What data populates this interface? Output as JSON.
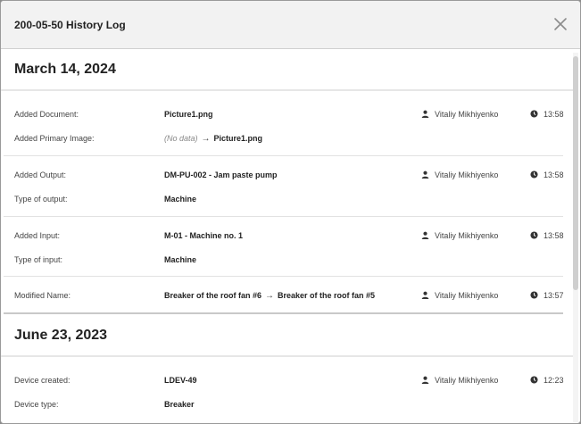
{
  "modal": {
    "title": "200-05-50 History Log"
  },
  "groups": [
    {
      "date": "March 14, 2024",
      "entries": [
        {
          "rows": [
            {
              "label": "Added Document:",
              "value": "Picture1.png",
              "user": "Vitaliy Mikhiyenko",
              "time": "13:58"
            },
            {
              "label": "Added Primary Image:",
              "old": "(No data)",
              "new": "Picture1.png"
            }
          ]
        },
        {
          "rows": [
            {
              "label": "Added Output:",
              "value": "DM-PU-002 - Jam paste pump",
              "user": "Vitaliy Mikhiyenko",
              "time": "13:58"
            },
            {
              "label": "Type of output:",
              "value": "Machine"
            }
          ]
        },
        {
          "rows": [
            {
              "label": "Added Input:",
              "value": "M-01 - Machine no. 1",
              "user": "Vitaliy Mikhiyenko",
              "time": "13:58"
            },
            {
              "label": "Type of input:",
              "value": "Machine"
            }
          ]
        },
        {
          "rows": [
            {
              "label": "Modified Name:",
              "old": "Breaker of the roof fan #6",
              "new": "Breaker of the roof fan #5",
              "user": "Vitaliy Mikhiyenko",
              "time": "13:57"
            }
          ]
        }
      ]
    },
    {
      "date": "June 23, 2023",
      "entries": [
        {
          "rows": [
            {
              "label": "Device created:",
              "value": "LDEV-49",
              "user": "Vitaliy Mikhiyenko",
              "time": "12:23"
            },
            {
              "label": "Device type:",
              "value": "Breaker"
            }
          ]
        }
      ]
    }
  ]
}
